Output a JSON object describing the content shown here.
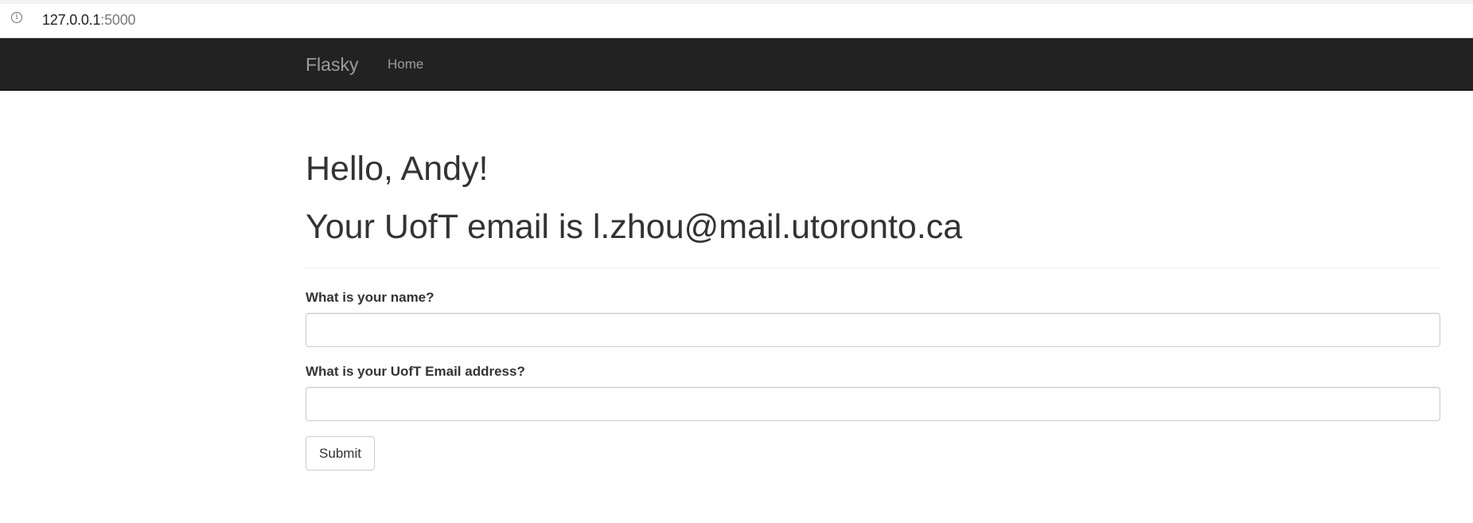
{
  "browser": {
    "url_host": "127.0.0.1",
    "url_port": ":5000",
    "info_icon": "info-icon"
  },
  "navbar": {
    "brand": "Flasky",
    "items": [
      {
        "label": "Home"
      }
    ],
    "background_color": "#222222",
    "text_color": "#9d9d9d"
  },
  "main": {
    "greeting": "Hello, Andy!",
    "email_message": "Your UofT email is l.zhou@mail.utoronto.ca",
    "form": {
      "name_label": "What is your name?",
      "name_value": "",
      "email_label": "What is your UofT Email address?",
      "email_value": "",
      "submit_label": "Submit"
    }
  }
}
